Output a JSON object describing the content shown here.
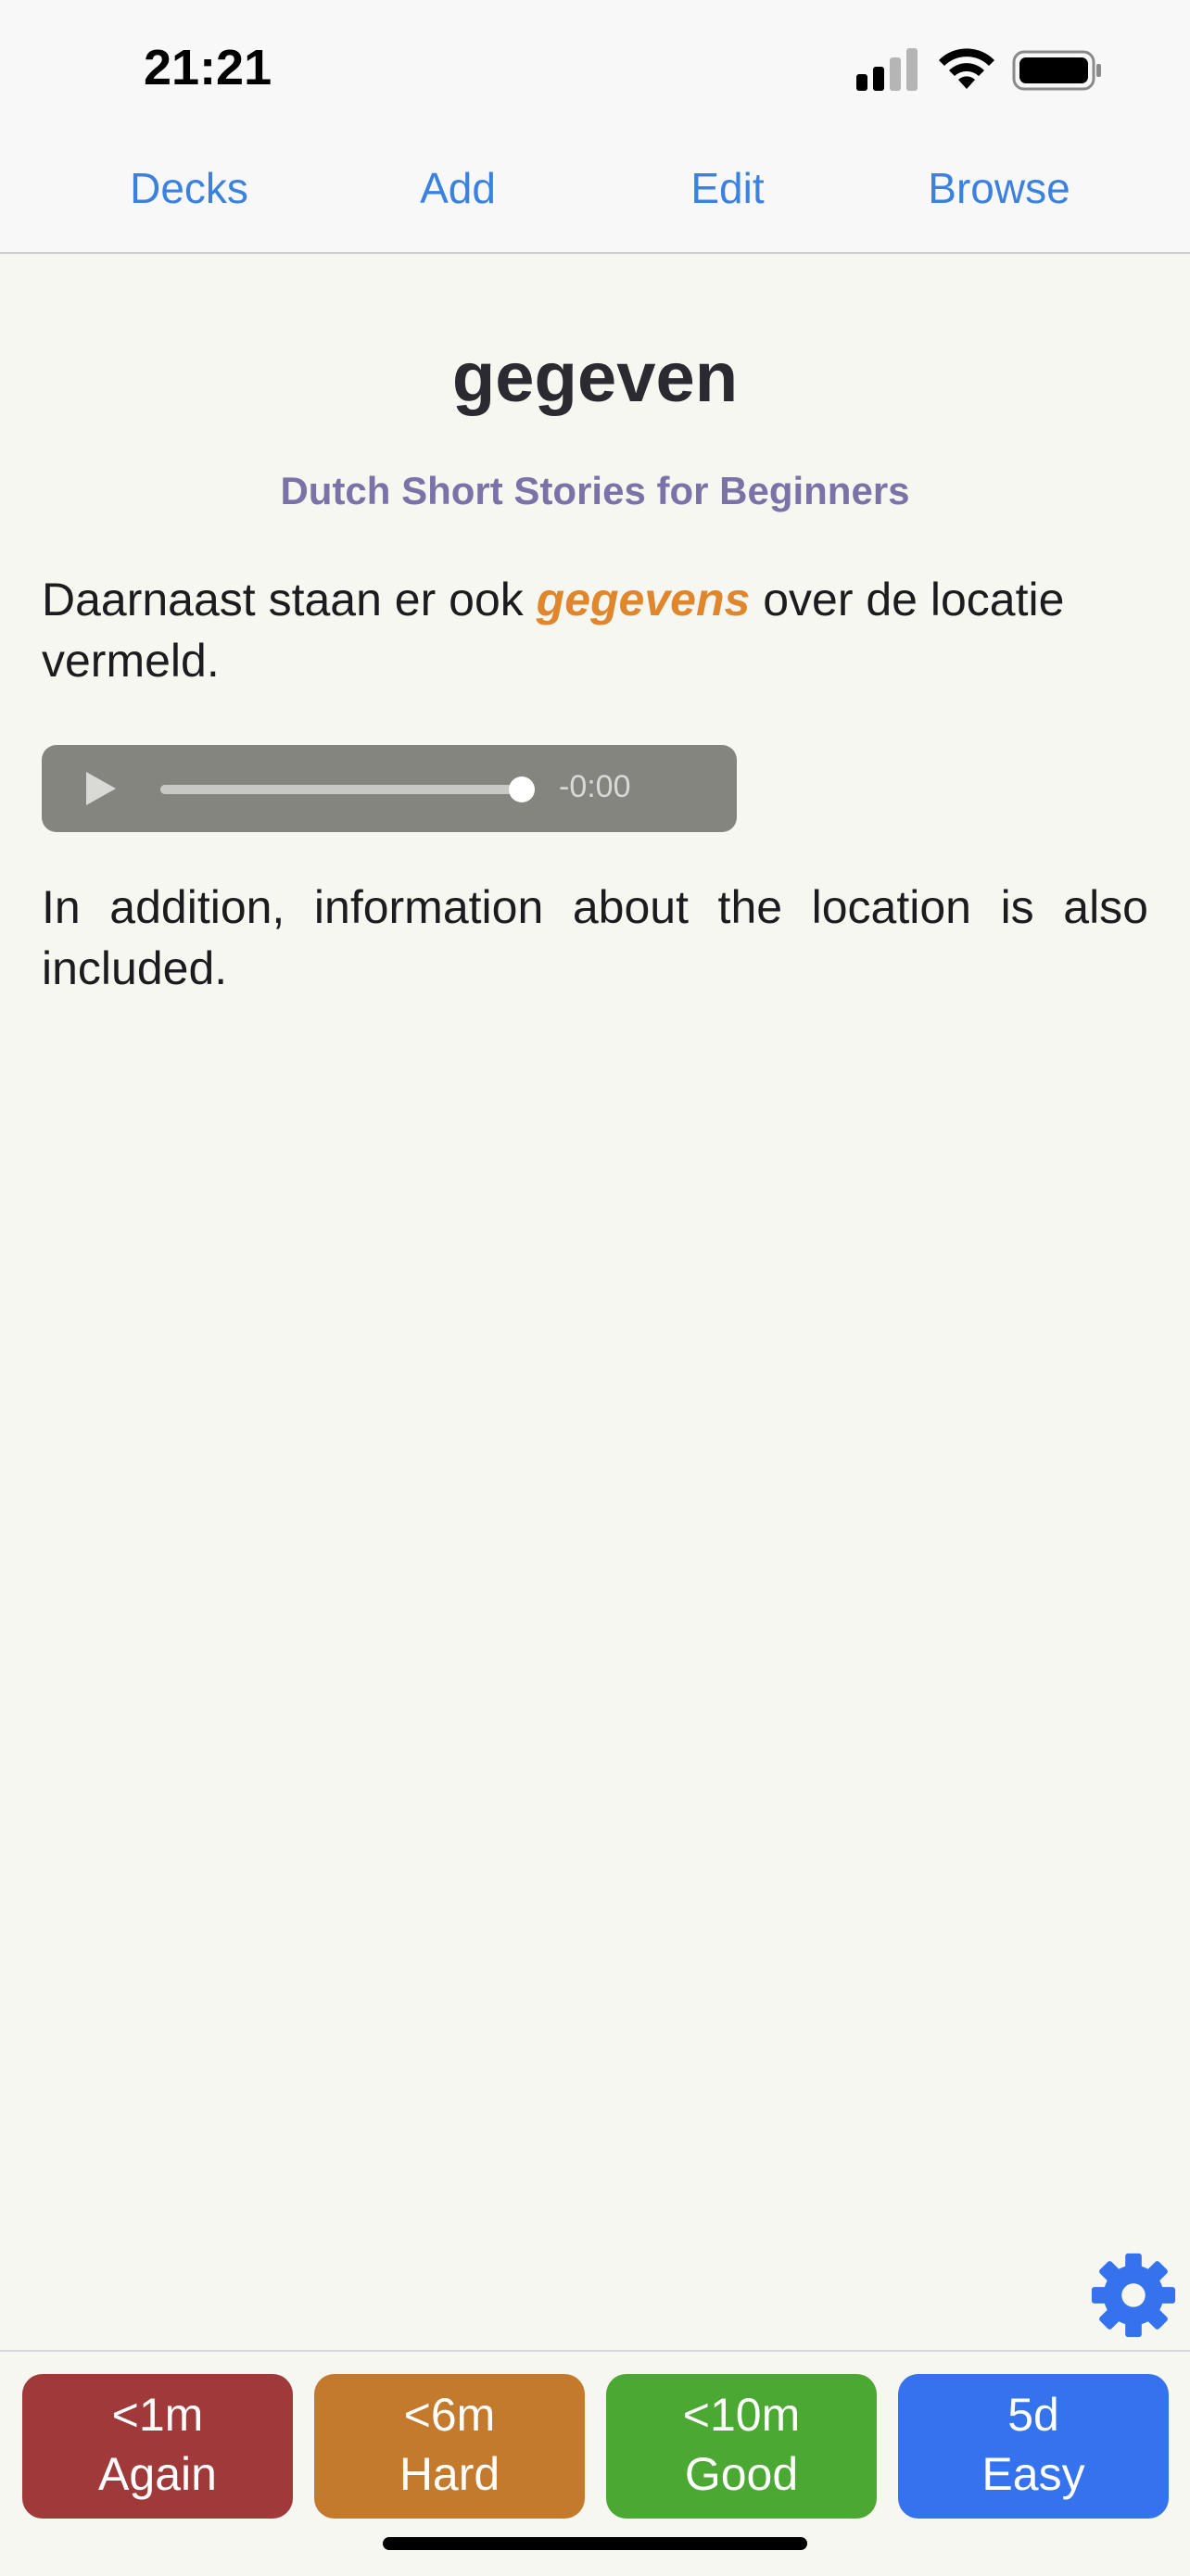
{
  "status_bar": {
    "time": "21:21",
    "icons": [
      "signal-icon",
      "wifi-icon",
      "battery-icon"
    ]
  },
  "nav": {
    "decks": "Decks",
    "add": "Add",
    "edit": "Edit",
    "browse": "Browse"
  },
  "card": {
    "word": "gegeven",
    "deck_name": "Dutch Short Stories for Beginners",
    "sentence_before": "Daarnaast staan er ook ",
    "sentence_highlight": "gegevens",
    "sentence_after": " over de locatie vermeld.",
    "translation": "In addition, information about the location is also included."
  },
  "audio": {
    "time": "-0:00",
    "progress": 1.0
  },
  "answers": {
    "again": {
      "interval": "<1m",
      "label": "Again"
    },
    "hard": {
      "interval": "<6m",
      "label": "Hard"
    },
    "good": {
      "interval": "<10m",
      "label": "Good"
    },
    "easy": {
      "interval": "5d",
      "label": "Easy"
    }
  },
  "colors": {
    "accent": "#3b82e0",
    "highlight": "#e0862c",
    "deck": "#7b72a8",
    "again": "#a0393a",
    "hard": "#c47a2c",
    "good": "#4aa833",
    "easy": "#3572ee"
  }
}
